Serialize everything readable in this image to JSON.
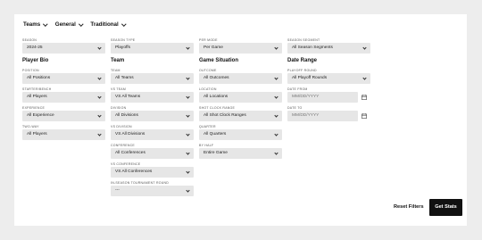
{
  "tabs": [
    {
      "label": "Teams"
    },
    {
      "label": "General"
    },
    {
      "label": "Traditional"
    }
  ],
  "col1": {
    "season": {
      "label": "SEASON",
      "value": "2024-25"
    },
    "section": "Player Bio",
    "position": {
      "label": "POSITION",
      "value": "All Positions"
    },
    "starter": {
      "label": "STARTER/BENCH",
      "value": "All Players"
    },
    "experience": {
      "label": "EXPERIENCE",
      "value": "All Experience"
    },
    "twoway": {
      "label": "TWO-WAY",
      "value": "All Players"
    }
  },
  "col2": {
    "season_type": {
      "label": "SEASON TYPE",
      "value": "Playoffs"
    },
    "section": "Team",
    "team": {
      "label": "TEAM",
      "value": "All Teams"
    },
    "vs_team": {
      "label": "VS TEAM",
      "value": "VS All Teams"
    },
    "division": {
      "label": "DIVISION",
      "value": "All Divisions"
    },
    "vs_division": {
      "label": "VS DIVISION",
      "value": "VS All Divisions"
    },
    "conference": {
      "label": "CONFERENCE",
      "value": "All Conferences"
    },
    "vs_conference": {
      "label": "VS CONFERENCE",
      "value": "VS All Conferences"
    },
    "ist_round": {
      "label": "IN-SEASON TOURNAMENT ROUND",
      "value": "---"
    }
  },
  "col3": {
    "per_mode": {
      "label": "PER MODE",
      "value": "Per Game"
    },
    "section": "Game Situation",
    "outcome": {
      "label": "OUTCOME",
      "value": "All Outcomes"
    },
    "location": {
      "label": "LOCATION",
      "value": "All Locations"
    },
    "shot_clock": {
      "label": "SHOT CLOCK RANGE",
      "value": "All Shot Clock Ranges"
    },
    "quarter": {
      "label": "QUARTER",
      "value": "All Quarters"
    },
    "half": {
      "label": "BY HALF",
      "value": "Entire Game"
    }
  },
  "col4": {
    "season_segment": {
      "label": "SEASON SEGMENT",
      "value": "All Season Segments"
    },
    "section": "Date Range",
    "playoff_round": {
      "label": "PLAYOFF ROUND",
      "value": "All Playoff Rounds"
    },
    "date_from": {
      "label": "DATE FROM",
      "placeholder": "MM/DD/YYYY"
    },
    "date_to": {
      "label": "DATE TO",
      "placeholder": "MM/DD/YYYY"
    }
  },
  "actions": {
    "reset": "Reset Filters",
    "get": "Get Stats"
  }
}
